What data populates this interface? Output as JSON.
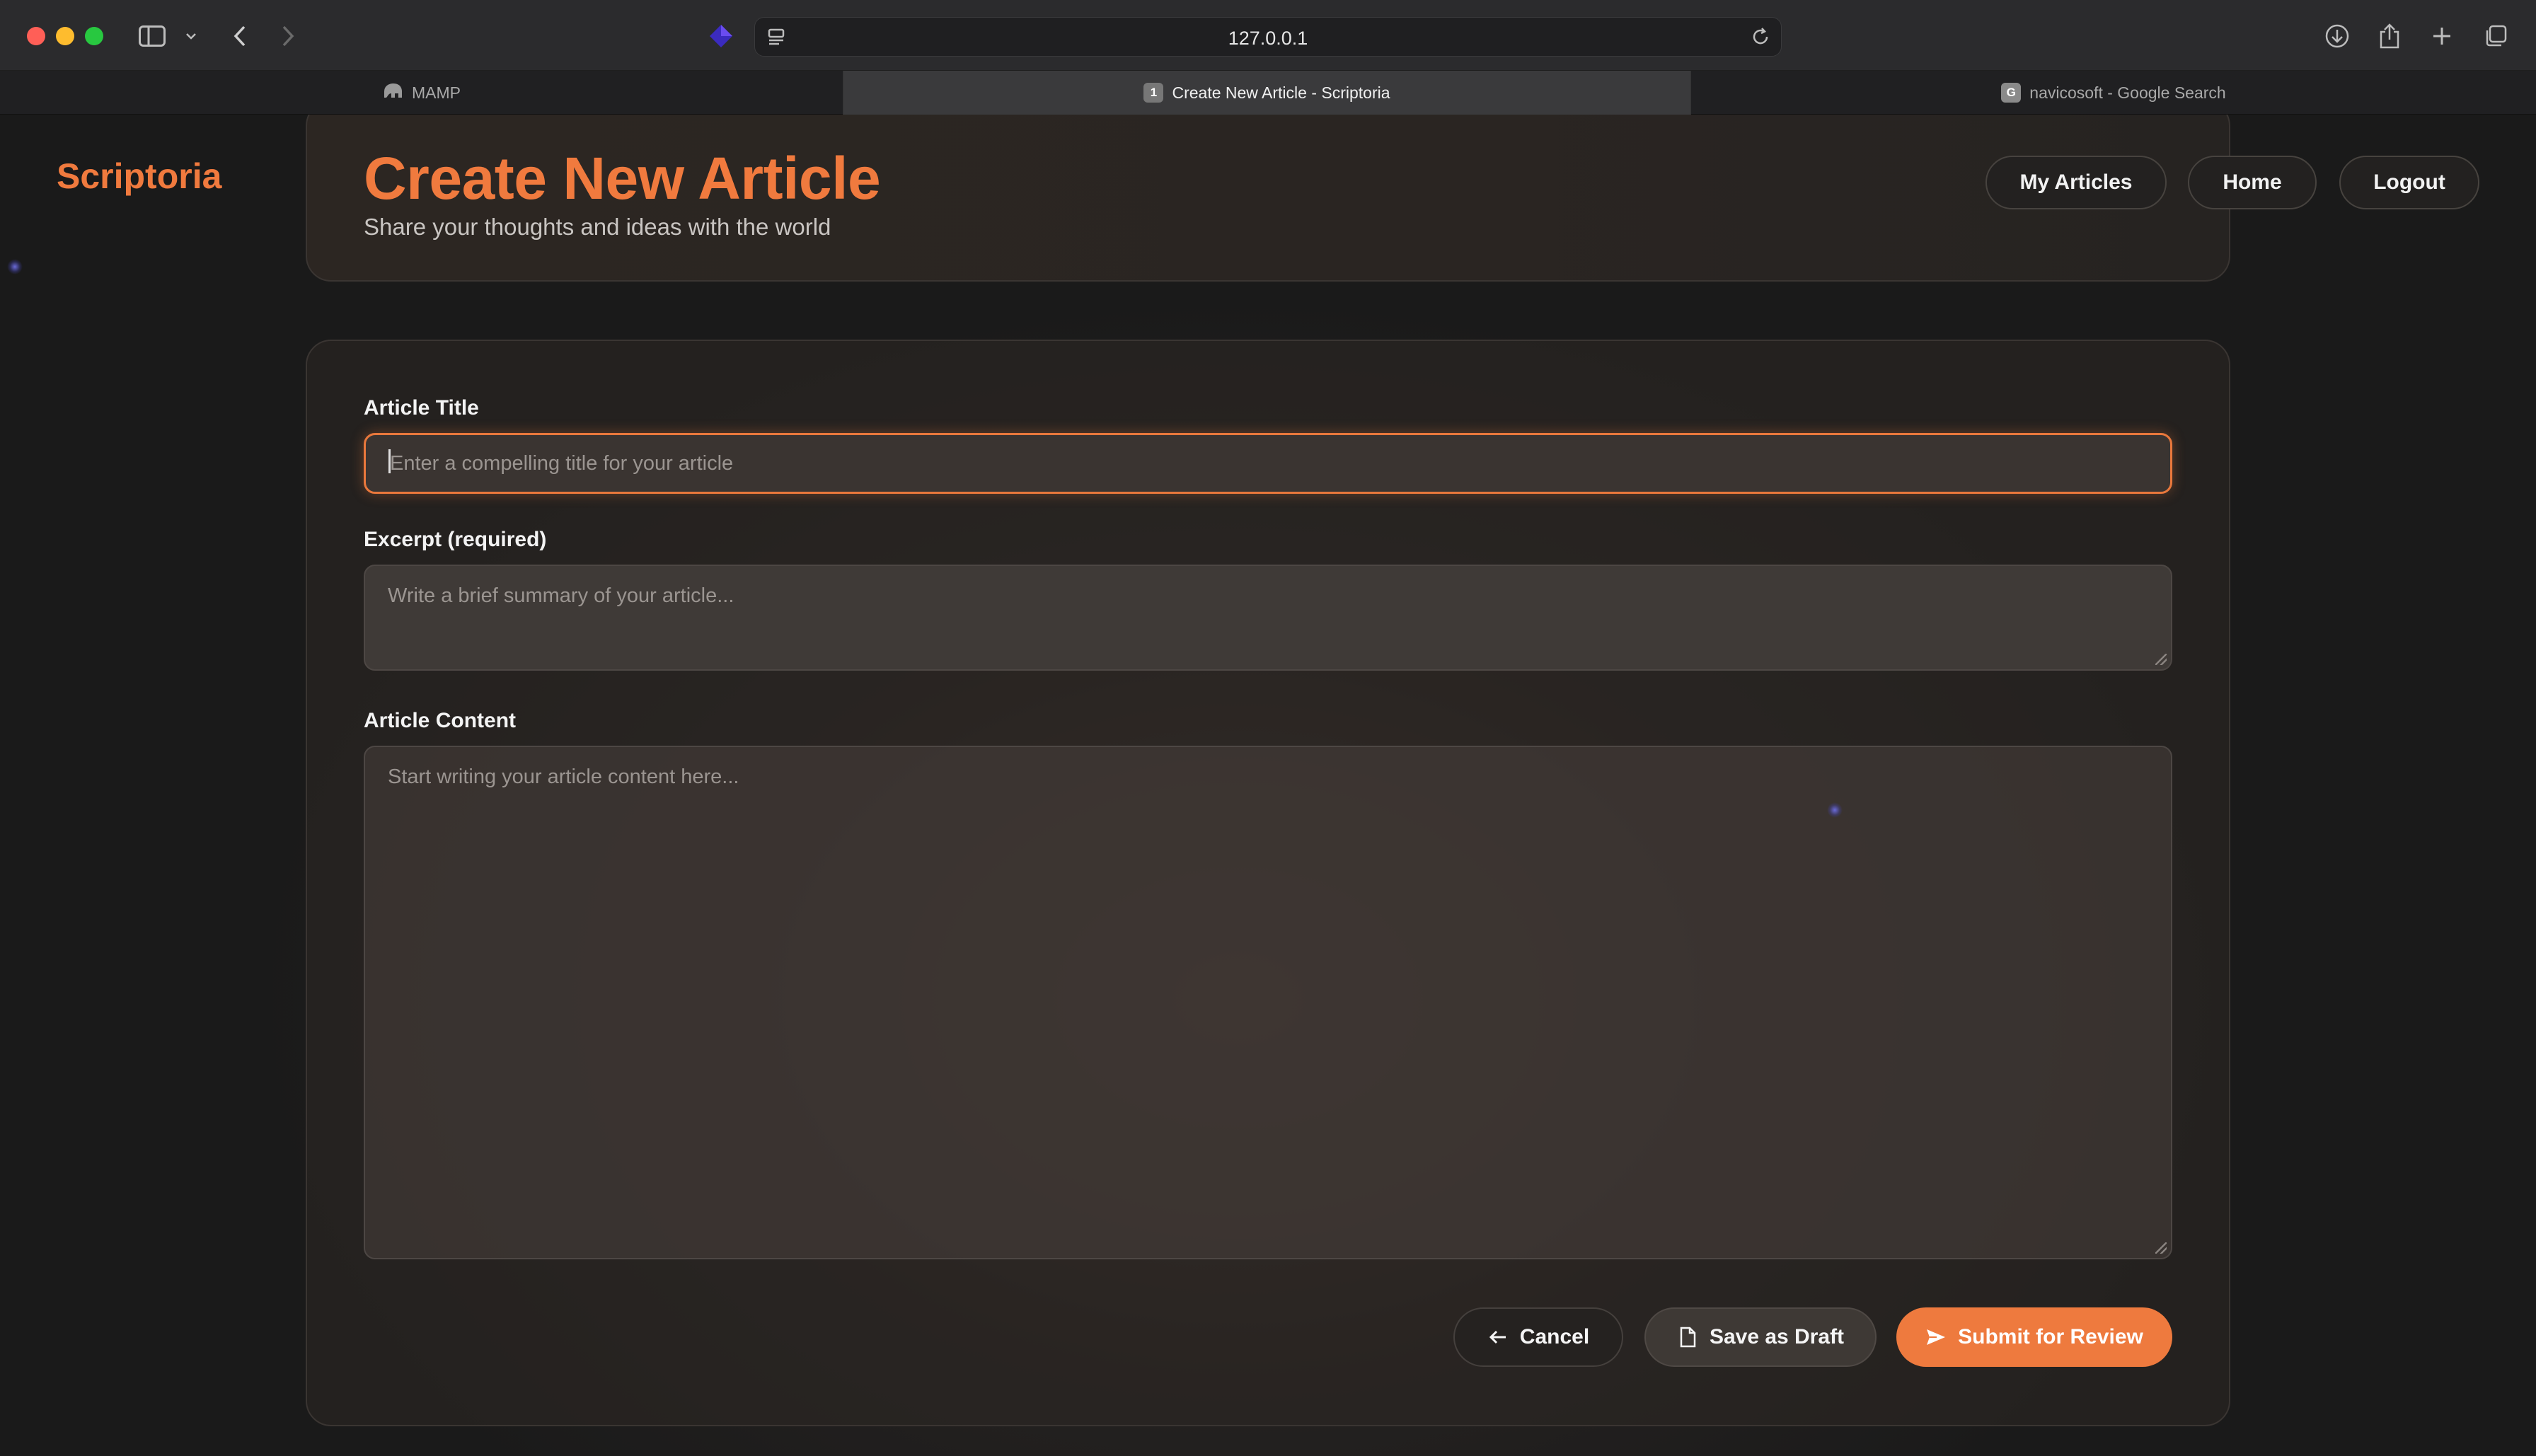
{
  "browser": {
    "url": "127.0.0.1",
    "tabs": [
      {
        "label": "MAMP",
        "active": false,
        "favicon": "elephant-icon"
      },
      {
        "label": "Create New Article - Scriptoria",
        "active": true,
        "favicon": "1"
      },
      {
        "label": "navicosoft - Google Search",
        "active": false,
        "favicon": "G"
      }
    ]
  },
  "app": {
    "brand": "Scriptoria"
  },
  "header": {
    "title": "Create New Article",
    "subtitle": "Share your thoughts and ideas with the world",
    "nav": {
      "my_articles": "My Articles",
      "home": "Home",
      "logout": "Logout"
    }
  },
  "form": {
    "title_label": "Article Title",
    "title_placeholder": "Enter a compelling title for your article",
    "title_value": "",
    "excerpt_label": "Excerpt (required)",
    "excerpt_placeholder": "Write a brief summary of your article...",
    "excerpt_value": "",
    "content_label": "Article Content",
    "content_placeholder": "Start writing your article content here...",
    "content_value": ""
  },
  "actions": {
    "cancel": "Cancel",
    "save_draft": "Save as Draft",
    "submit": "Submit for Review"
  },
  "colors": {
    "accent": "#ee7a3e",
    "background": "#1a1a1a"
  }
}
